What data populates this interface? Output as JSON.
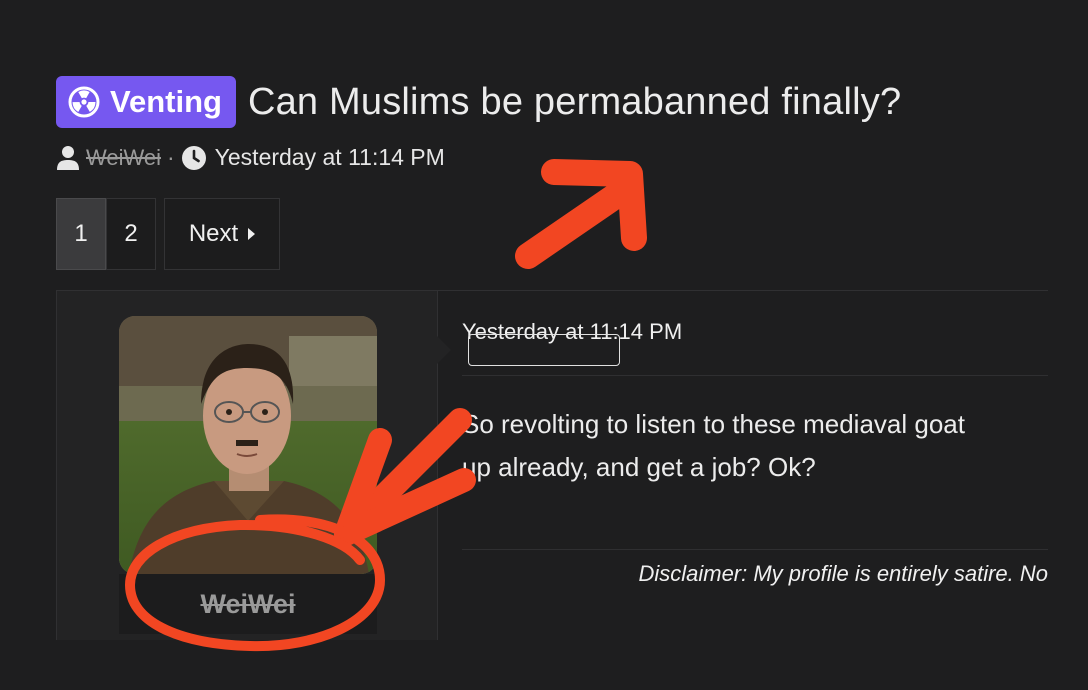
{
  "thread": {
    "prefix_label": "Venting",
    "prefix_icon": "radiation-icon",
    "title": "Can Muslims be permabanned finally?",
    "author": "WeiWei",
    "separator": "·",
    "timestamp": "Yesterday at 11:14 PM"
  },
  "pagination": {
    "pages": [
      "1",
      "2"
    ],
    "current_page": "1",
    "next_label": "Next"
  },
  "post": {
    "date": "Yesterday at 11:14 PM",
    "body_lines": [
      "So revolting to listen to these mediaval goat",
      "up already, and get a job? Ok?"
    ],
    "signature": "Disclaimer: My profile is entirely satire. No",
    "author_name": "WeiWei",
    "avatar_description": "user-avatar-photo"
  },
  "colors": {
    "background": "#1e1e1f",
    "prefix_badge": "#7658f0",
    "annotation_red": "#f24622",
    "muted_text": "#9a9a9a"
  }
}
